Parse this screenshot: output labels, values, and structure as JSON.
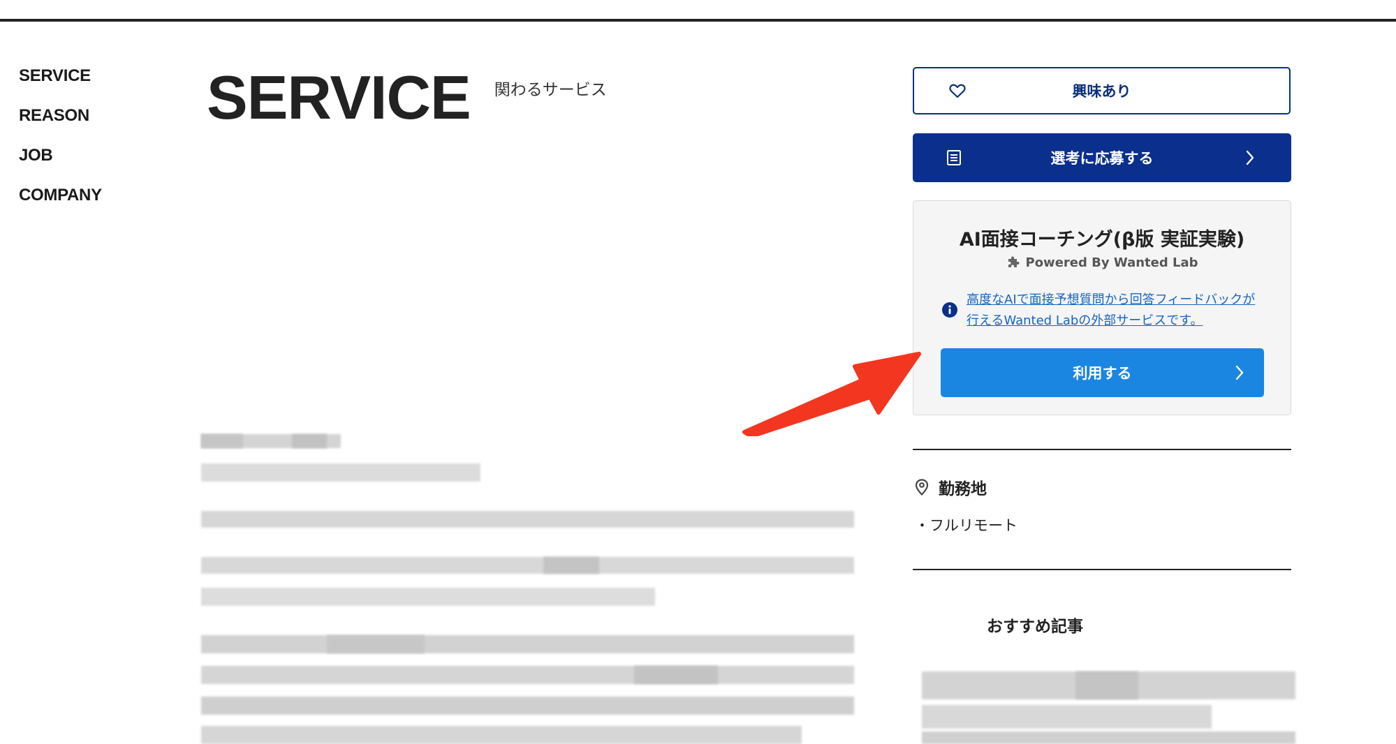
{
  "nav": {
    "items": [
      {
        "label": "SERVICE"
      },
      {
        "label": "REASON"
      },
      {
        "label": "JOB"
      },
      {
        "label": "COMPANY"
      }
    ]
  },
  "heading": {
    "title": "SERVICE",
    "subtitle": "関わるサービス"
  },
  "actions": {
    "interest_label": "興味あり",
    "apply_label": "選考に応募する"
  },
  "ai_card": {
    "title": "AI面接コーチング(β版 実証実験)",
    "powered_by": "Powered By Wanted Lab",
    "description": "高度なAIで面接予想質問から回答フィードバックが行えるWanted Labの外部サービスです。",
    "use_label": "利用する"
  },
  "location": {
    "heading": "勤務地",
    "items": [
      "・フルリモート"
    ]
  },
  "recommended": {
    "heading": "おすすめ記事"
  },
  "colors": {
    "navy": "#0a2f8c",
    "accent_blue": "#1a86e2",
    "link_blue": "#1565c0",
    "arrow_red": "#f2361f"
  }
}
